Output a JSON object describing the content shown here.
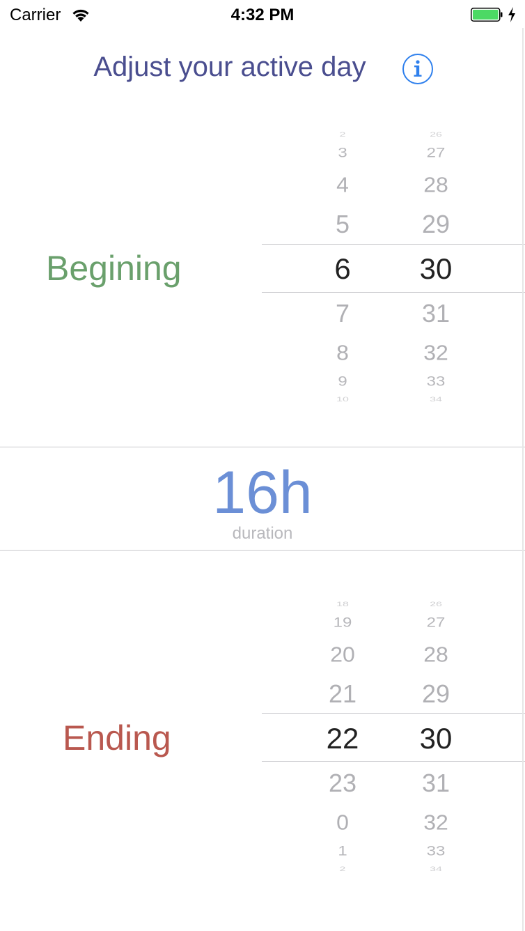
{
  "status_bar": {
    "carrier": "Carrier",
    "time": "4:32 PM",
    "wifi_icon": "wifi-icon",
    "battery_icon": "battery-icon",
    "charging_icon": "bolt-icon",
    "battery_color": "#4cd964"
  },
  "header": {
    "title": "Adjust your active day",
    "info_icon": "info-icon",
    "info_color": "#2f80ed"
  },
  "beginning": {
    "label": "Begining",
    "label_color": "#6aa06c",
    "hours": [
      "2",
      "3",
      "4",
      "5",
      "6",
      "7",
      "8",
      "9",
      "10"
    ],
    "minutes": [
      "26",
      "27",
      "28",
      "29",
      "30",
      "31",
      "32",
      "33",
      "34"
    ],
    "selected_hour": "6",
    "selected_minute": "30"
  },
  "duration": {
    "value": "16h",
    "caption": "duration",
    "value_color": "#6b8fd6"
  },
  "ending": {
    "label": "Ending",
    "label_color": "#b9584f",
    "hours": [
      "18",
      "19",
      "20",
      "21",
      "22",
      "23",
      "0",
      "1",
      "2"
    ],
    "minutes": [
      "26",
      "27",
      "28",
      "29",
      "30",
      "31",
      "32",
      "33",
      "34"
    ],
    "selected_hour": "22",
    "selected_minute": "30"
  }
}
